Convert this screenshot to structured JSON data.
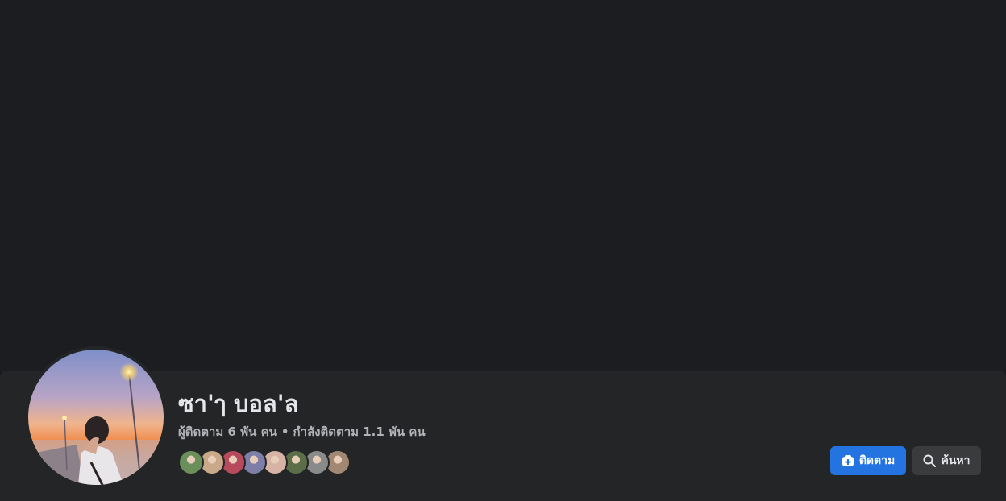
{
  "profile": {
    "name": "ซา'ๅ บอล'ล",
    "followers_text": "ผู้ติดตาม 6 พัน คน",
    "separator": "•",
    "following_text": "กำลังติดตาม 1.1 พัน คน"
  },
  "follower_avatars": [
    {
      "name": "follower-avatar-1",
      "color": "#6b8f5a"
    },
    {
      "name": "follower-avatar-2",
      "color": "#c9a98a"
    },
    {
      "name": "follower-avatar-3",
      "color": "#b84a5e"
    },
    {
      "name": "follower-avatar-4",
      "color": "#7d7fa8"
    },
    {
      "name": "follower-avatar-5",
      "color": "#d6b3a5"
    },
    {
      "name": "follower-avatar-6",
      "color": "#5c6e48"
    },
    {
      "name": "follower-avatar-7",
      "color": "#8a8a8a"
    },
    {
      "name": "follower-avatar-8",
      "color": "#a28872"
    }
  ],
  "actions": {
    "follow_label": "ติดตาม",
    "follow_icon": "add-friend-icon",
    "search_label": "ค้นหา",
    "search_icon": "search-icon"
  },
  "colors": {
    "background": "#18191a",
    "cover": "#1c1d20",
    "band": "#242526",
    "accent": "#2374e1",
    "secondary_button": "#3a3b3c"
  }
}
